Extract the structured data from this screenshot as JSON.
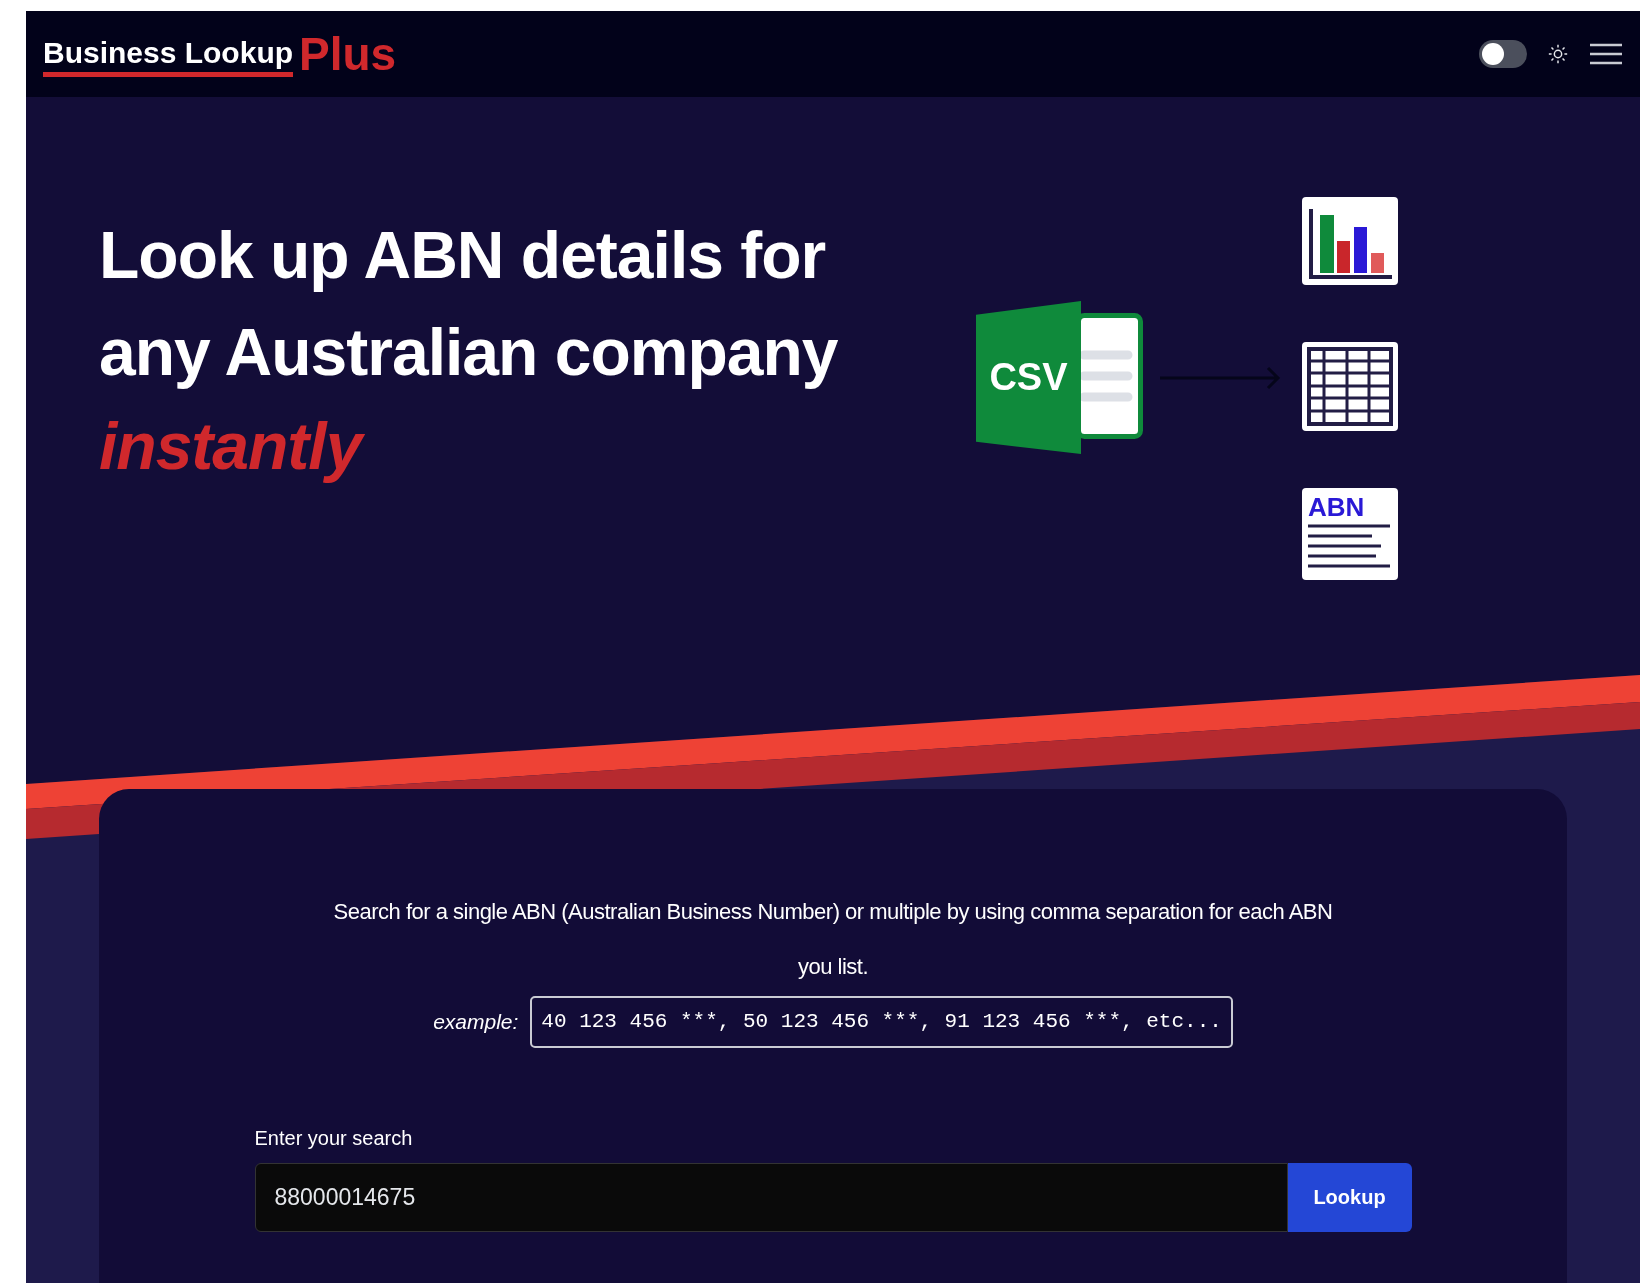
{
  "header": {
    "logo": "Business Lookup",
    "logo_accent": "Plus",
    "theme_toggle": {
      "on": false
    }
  },
  "hero": {
    "heading_lines": [
      "Look up ABN details for",
      "any Australian company"
    ],
    "heading_accent": "instantly",
    "csv_label": "CSV",
    "abn_label": "ABN"
  },
  "search": {
    "description": "Search for a single ABN (Australian Business Number) or multiple by using comma separation for each ABN you list.",
    "example_label": "example:",
    "example_value": "40 123 456 ***, 50 123 456 ***, 91 123 456 ***, etc...",
    "field_label": "Enter your search",
    "field_value": "88000014675",
    "button": "Lookup"
  }
}
